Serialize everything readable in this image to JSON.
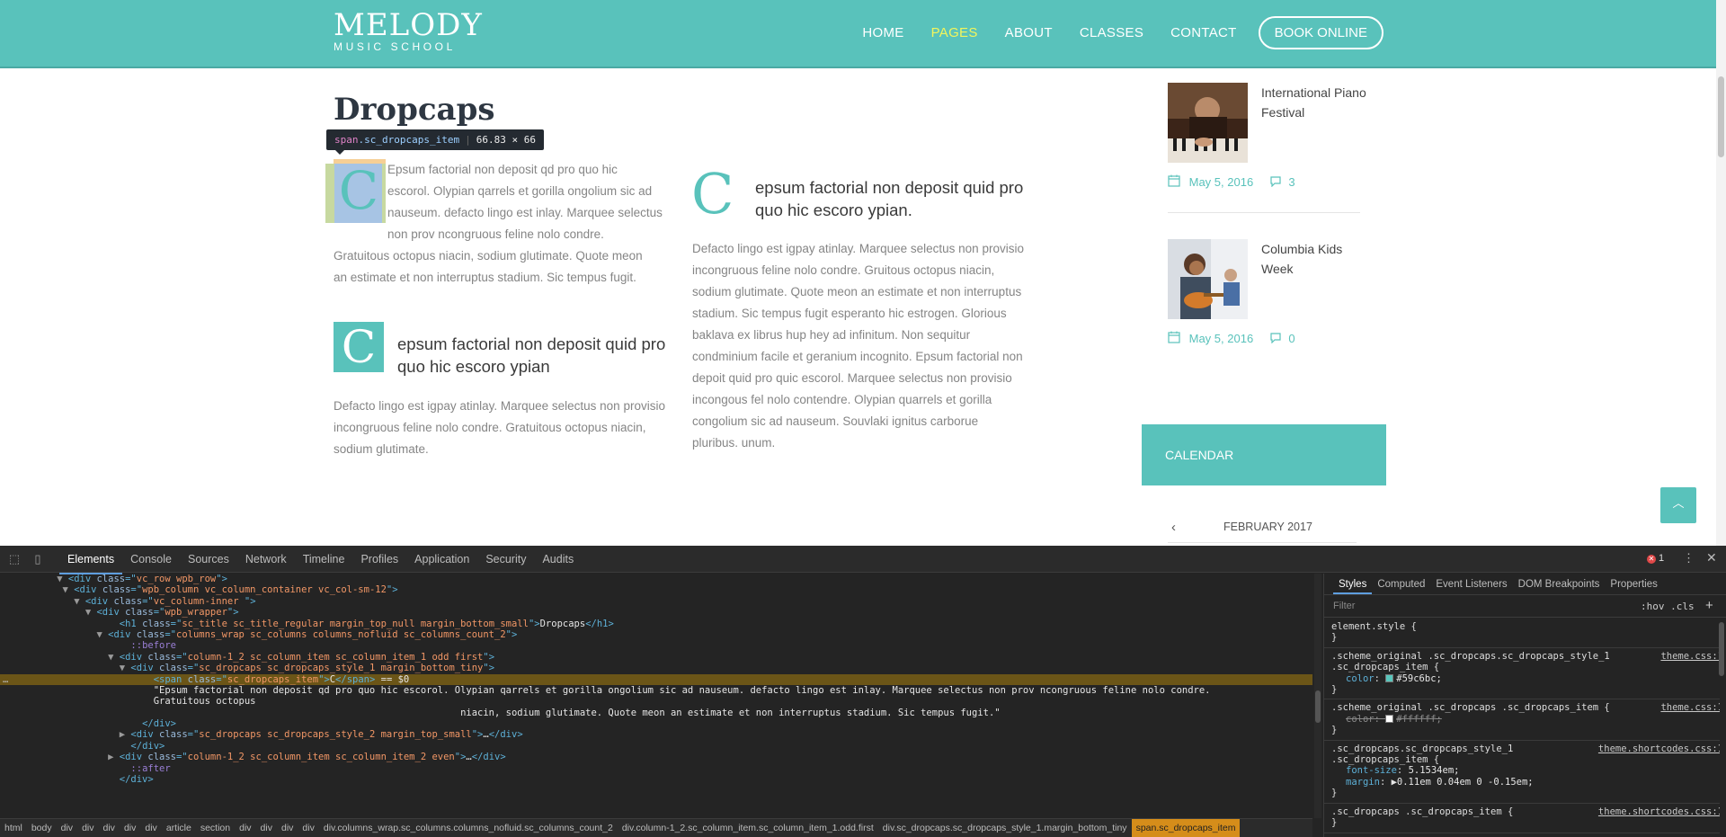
{
  "site": {
    "logo": {
      "line1": "MELODY",
      "line2": "MUSIC SCHOOL"
    },
    "nav": [
      {
        "label": "HOME",
        "active": false
      },
      {
        "label": "PAGES",
        "active": true
      },
      {
        "label": "ABOUT",
        "active": false
      },
      {
        "label": "CLASSES",
        "active": false
      },
      {
        "label": "CONTACT",
        "active": false
      }
    ],
    "book_online": "BOOK ONLINE",
    "title": "Dropcaps",
    "tooltip": {
      "tag": "span",
      "cls": ".sc_dropcaps_item",
      "size": "66.83 × 66"
    },
    "dropcap1": {
      "letter": "C",
      "lines": [
        "Epsum factorial non deposit qd pro quo hic",
        "escorol. Olypian qarrels et gorilla ongolium sic ad",
        "nauseum. defacto lingo est inlay. Marquee selectus",
        "non prov ncongruous feline nolo condre.",
        "Gratuitous octopus niacin, sodium glutimate. Quote meon",
        "an estimate et non interruptus stadium. Sic tempus fugit."
      ]
    },
    "dropcap2": {
      "letter": "C",
      "lead": "epsum factorial non deposit quid pro quo hic escoro ypian",
      "body": "Defacto lingo est igpay atinlay. Marquee selectus non provisio incongruous feline nolo condre. Gratuitous octopus niacin, sodium glutimate."
    },
    "dropcap3": {
      "letter": "C",
      "lead": "epsum factorial non deposit quid pro quo hic escoro ypian.",
      "body": "Defacto lingo est igpay atinlay. Marquee selectus non provisio incongruous feline nolo condre. Gruitous octopus niacin, sodium glutimate. Quote meon an estimate et non interruptus stadium. Sic tempus fugit esperanto hic estrogen. Glorious baklava ex librus hup hey ad infinitum. Non sequitur condminium facile et geranium incognito. Epsum factorial non depoit quid pro quic escorol. Marquee selectus non provisio incongous fel nolo contendre. Olypian quarrels et gorilla congolium sic ad nauseum. Souvlaki ignitus carborue pluribus. unum."
    },
    "posts": [
      {
        "title": "International Piano Festival",
        "date": "May 5, 2016",
        "comments": "3"
      },
      {
        "title": "Columbia Kids Week",
        "date": "May 5, 2016",
        "comments": "0"
      }
    ],
    "calendar": {
      "heading": "CALENDAR",
      "month": "FEBRUARY 2017"
    },
    "colors": {
      "accent": "#59c2bb",
      "nav_active": "#f2f55c"
    }
  },
  "devtools": {
    "tabs": [
      "Elements",
      "Console",
      "Sources",
      "Network",
      "Timeline",
      "Profiles",
      "Application",
      "Security",
      "Audits"
    ],
    "selected_tab": "Elements",
    "error_count": "1",
    "dom_lines": [
      {
        "indent": 12,
        "arrow": "▼",
        "parts": [
          [
            "tg",
            "<div "
          ],
          [
            "at",
            "class"
          ],
          [
            "tg",
            "=\""
          ],
          [
            "av",
            "vc_row wpb_row"
          ],
          [
            "tg",
            "\">"
          ]
        ]
      },
      {
        "indent": 13,
        "arrow": "▼",
        "parts": [
          [
            "tg",
            "<div "
          ],
          [
            "at",
            "class"
          ],
          [
            "tg",
            "=\""
          ],
          [
            "av",
            "wpb_column vc_column_container vc_col-sm-12"
          ],
          [
            "tg",
            "\">"
          ]
        ]
      },
      {
        "indent": 15,
        "arrow": "▼",
        "parts": [
          [
            "tg",
            "<div "
          ],
          [
            "at",
            "class"
          ],
          [
            "tg",
            "=\""
          ],
          [
            "av",
            "vc_column-inner "
          ],
          [
            "tg",
            "\">"
          ]
        ]
      },
      {
        "indent": 17,
        "arrow": "▼",
        "parts": [
          [
            "tg",
            "<div "
          ],
          [
            "at",
            "class"
          ],
          [
            "tg",
            "=\""
          ],
          [
            "av",
            "wpb_wrapper"
          ],
          [
            "tg",
            "\">"
          ]
        ]
      },
      {
        "indent": 21,
        "arrow": "",
        "parts": [
          [
            "tg",
            "<h1 "
          ],
          [
            "at",
            "class"
          ],
          [
            "tg",
            "=\""
          ],
          [
            "av",
            "sc_title sc_title_regular margin_top_null margin_bottom_small"
          ],
          [
            "tg",
            "\">"
          ],
          [
            "tx",
            "Dropcaps"
          ],
          [
            "tg",
            "</h1>"
          ]
        ]
      },
      {
        "indent": 19,
        "arrow": "▼",
        "parts": [
          [
            "tg",
            "<div "
          ],
          [
            "at",
            "class"
          ],
          [
            "tg",
            "=\""
          ],
          [
            "av",
            "columns_wrap sc_columns columns_nofluid sc_columns_count_2"
          ],
          [
            "tg",
            "\">"
          ]
        ]
      },
      {
        "indent": 23,
        "arrow": "",
        "parts": [
          [
            "ps",
            "::before"
          ]
        ]
      },
      {
        "indent": 21,
        "arrow": "▼",
        "parts": [
          [
            "tg",
            "<div "
          ],
          [
            "at",
            "class"
          ],
          [
            "tg",
            "=\""
          ],
          [
            "av",
            "column-1_2 sc_column_item sc_column_item_1 odd first"
          ],
          [
            "tg",
            "\">"
          ]
        ]
      },
      {
        "indent": 23,
        "arrow": "▼",
        "parts": [
          [
            "tg",
            "<div "
          ],
          [
            "at",
            "class"
          ],
          [
            "tg",
            "=\""
          ],
          [
            "av",
            "sc_dropcaps sc_dropcaps_style_1 margin_bottom_tiny"
          ],
          [
            "tg",
            "\">"
          ]
        ]
      },
      {
        "indent": 27,
        "arrow": "",
        "sel": true,
        "parts": [
          [
            "tg",
            "<span "
          ],
          [
            "at",
            "class"
          ],
          [
            "tg",
            "=\""
          ],
          [
            "av",
            "sc_dropcaps_item"
          ],
          [
            "tg",
            "\">"
          ],
          [
            "tx",
            "C"
          ],
          [
            "tg",
            "</span>"
          ],
          [
            "tx",
            " == $0"
          ]
        ]
      },
      {
        "indent": 27,
        "arrow": "",
        "parts": [
          [
            "tx",
            "\"Epsum factorial non deposit qd pro quo hic escorol. Olypian qarrels et gorilla ongolium sic ad nauseum. defacto lingo est inlay. Marquee selectus non prov ncongruous feline nolo condre."
          ]
        ]
      },
      {
        "indent": 27,
        "arrow": "",
        "parts": [
          [
            "tx",
            "Gratuitous octopus"
          ]
        ]
      },
      {
        "indent": 81,
        "arrow": "",
        "parts": [
          [
            "tx",
            "niacin, sodium glutimate. Quote meon an estimate et non interruptus stadium. Sic tempus fugit.\""
          ]
        ]
      },
      {
        "indent": 25,
        "arrow": "",
        "parts": [
          [
            "tg",
            "</div>"
          ]
        ]
      },
      {
        "indent": 23,
        "arrow": "▶",
        "parts": [
          [
            "tg",
            "<div "
          ],
          [
            "at",
            "class"
          ],
          [
            "tg",
            "=\""
          ],
          [
            "av",
            "sc_dropcaps sc_dropcaps_style_2 margin_top_small"
          ],
          [
            "tg",
            "\">"
          ],
          [
            "tx",
            "…"
          ],
          [
            "tg",
            "</div>"
          ]
        ]
      },
      {
        "indent": 23,
        "arrow": "",
        "parts": [
          [
            "tg",
            "</div>"
          ]
        ]
      },
      {
        "indent": 21,
        "arrow": "▶",
        "parts": [
          [
            "tg",
            "<div "
          ],
          [
            "at",
            "class"
          ],
          [
            "tg",
            "=\""
          ],
          [
            "av",
            "column-1_2 sc_column_item sc_column_item_2 even"
          ],
          [
            "tg",
            "\">"
          ],
          [
            "tx",
            "…"
          ],
          [
            "tg",
            "</div>"
          ]
        ]
      },
      {
        "indent": 23,
        "arrow": "",
        "parts": [
          [
            "ps",
            "::after"
          ]
        ]
      },
      {
        "indent": 21,
        "arrow": "",
        "parts": [
          [
            "tg",
            "</div>"
          ]
        ]
      }
    ],
    "styles_tabs": [
      "Styles",
      "Computed",
      "Event Listeners",
      "DOM Breakpoints",
      "Properties"
    ],
    "filter_placeholder": "Filter",
    "filter_toggles": ":hov .cls",
    "rules": [
      {
        "selector": "element.style {",
        "source": "",
        "props": []
      },
      {
        "selector": ".scheme_original .sc_dropcaps.sc_dropcaps_style_1\n.sc_dropcaps_item {",
        "source": "theme.css:1",
        "props": [
          {
            "name": "color",
            "value": "#59c6bc;",
            "swatch": "#59c6bc",
            "strike": false
          }
        ]
      },
      {
        "selector": ".scheme_original .sc_dropcaps .sc_dropcaps_item {",
        "source": "theme.css:1",
        "props": [
          {
            "name": "color",
            "value": "#ffffff;",
            "swatch": "#ffffff",
            "strike": true
          }
        ]
      },
      {
        "selector": ".sc_dropcaps.sc_dropcaps_style_1\n.sc_dropcaps_item {",
        "source": "theme.shortcodes.css:1",
        "props": [
          {
            "name": "font-size",
            "value": "5.1534em;",
            "swatch": "",
            "strike": false
          },
          {
            "name": "margin",
            "value": "▶0.11em 0.04em 0 -0.15em;",
            "swatch": "",
            "strike": false
          }
        ]
      },
      {
        "selector": ".sc_dropcaps .sc_dropcaps_item {",
        "source": "theme.shortcodes.css:1",
        "props": []
      }
    ],
    "breadcrumbs": [
      "html",
      "body",
      "div",
      "div",
      "div",
      "div",
      "div",
      "article",
      "section",
      "div",
      "div",
      "div",
      "div",
      "div.columns_wrap.sc_columns.columns_nofluid.sc_columns_count_2",
      "div.column-1_2.sc_column_item.sc_column_item_1.odd.first",
      "div.sc_dropcaps.sc_dropcaps_style_1.margin_bottom_tiny",
      "span.sc_dropcaps_item"
    ]
  }
}
